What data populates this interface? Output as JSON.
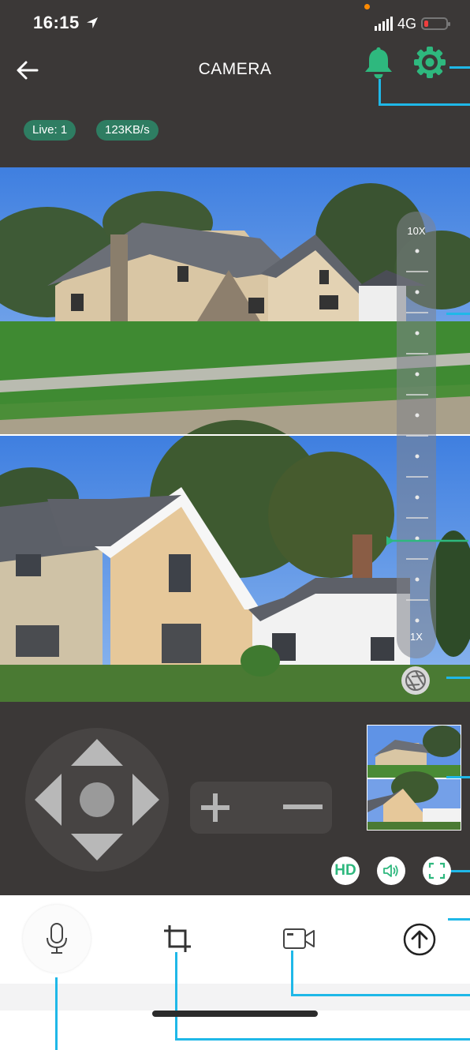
{
  "status_bar": {
    "time": "16:15",
    "network": "4G"
  },
  "header": {
    "title": "CAMERA"
  },
  "badges": {
    "live": "Live: 1",
    "speed": "123KB/s"
  },
  "zoom": {
    "max_label": "10X",
    "min_label": "1X"
  },
  "controls": {
    "hd_label": "HD"
  },
  "icons": {
    "back": "arrow-left-icon",
    "alarm": "bell-icon",
    "settings": "gear-icon",
    "shutter": "aperture-icon",
    "mic": "microphone-icon",
    "crop": "crop-icon",
    "record": "video-camera-icon",
    "upload": "upload-circle-icon",
    "volume": "speaker-icon",
    "fullscreen": "fullscreen-icon"
  },
  "colors": {
    "accent": "#2eb87e",
    "badge_bg": "#2e7d62",
    "background": "#3b3837",
    "annotation": "#1fb8e8"
  }
}
